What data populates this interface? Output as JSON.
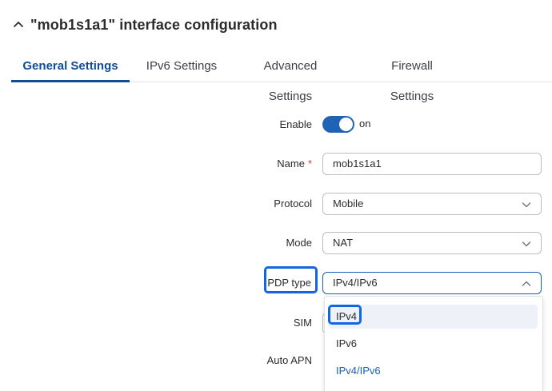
{
  "header": {
    "title": "\"mob1s1a1\" interface configuration"
  },
  "tabs": [
    {
      "label": "General Settings",
      "active": true
    },
    {
      "label": "IPv6 Settings",
      "active": false
    },
    {
      "label": "Advanced Settings",
      "active": false
    },
    {
      "label": "Firewall Settings",
      "active": false
    }
  ],
  "form": {
    "enable": {
      "label": "Enable",
      "state": "on"
    },
    "name": {
      "label": "Name",
      "required_mark": "*",
      "value": "mob1s1a1"
    },
    "protocol": {
      "label": "Protocol",
      "value": "Mobile"
    },
    "mode": {
      "label": "Mode",
      "value": "NAT"
    },
    "pdp_type": {
      "label": "PDP type",
      "value": "IPv4/IPv6",
      "options": [
        "IPv4",
        "IPv6",
        "IPv4/IPv6"
      ]
    },
    "sim": {
      "label": "SIM"
    },
    "auto_apn": {
      "label": "Auto APN"
    }
  },
  "colors": {
    "accent": "#0f4d92",
    "toggle_on": "#1f64b4",
    "highlight": "#1565e0",
    "required": "#e03b3b"
  },
  "icons": {
    "collapse": "chevron-up-icon",
    "select": "chevron-down-icon",
    "select_open": "chevron-up-icon"
  }
}
